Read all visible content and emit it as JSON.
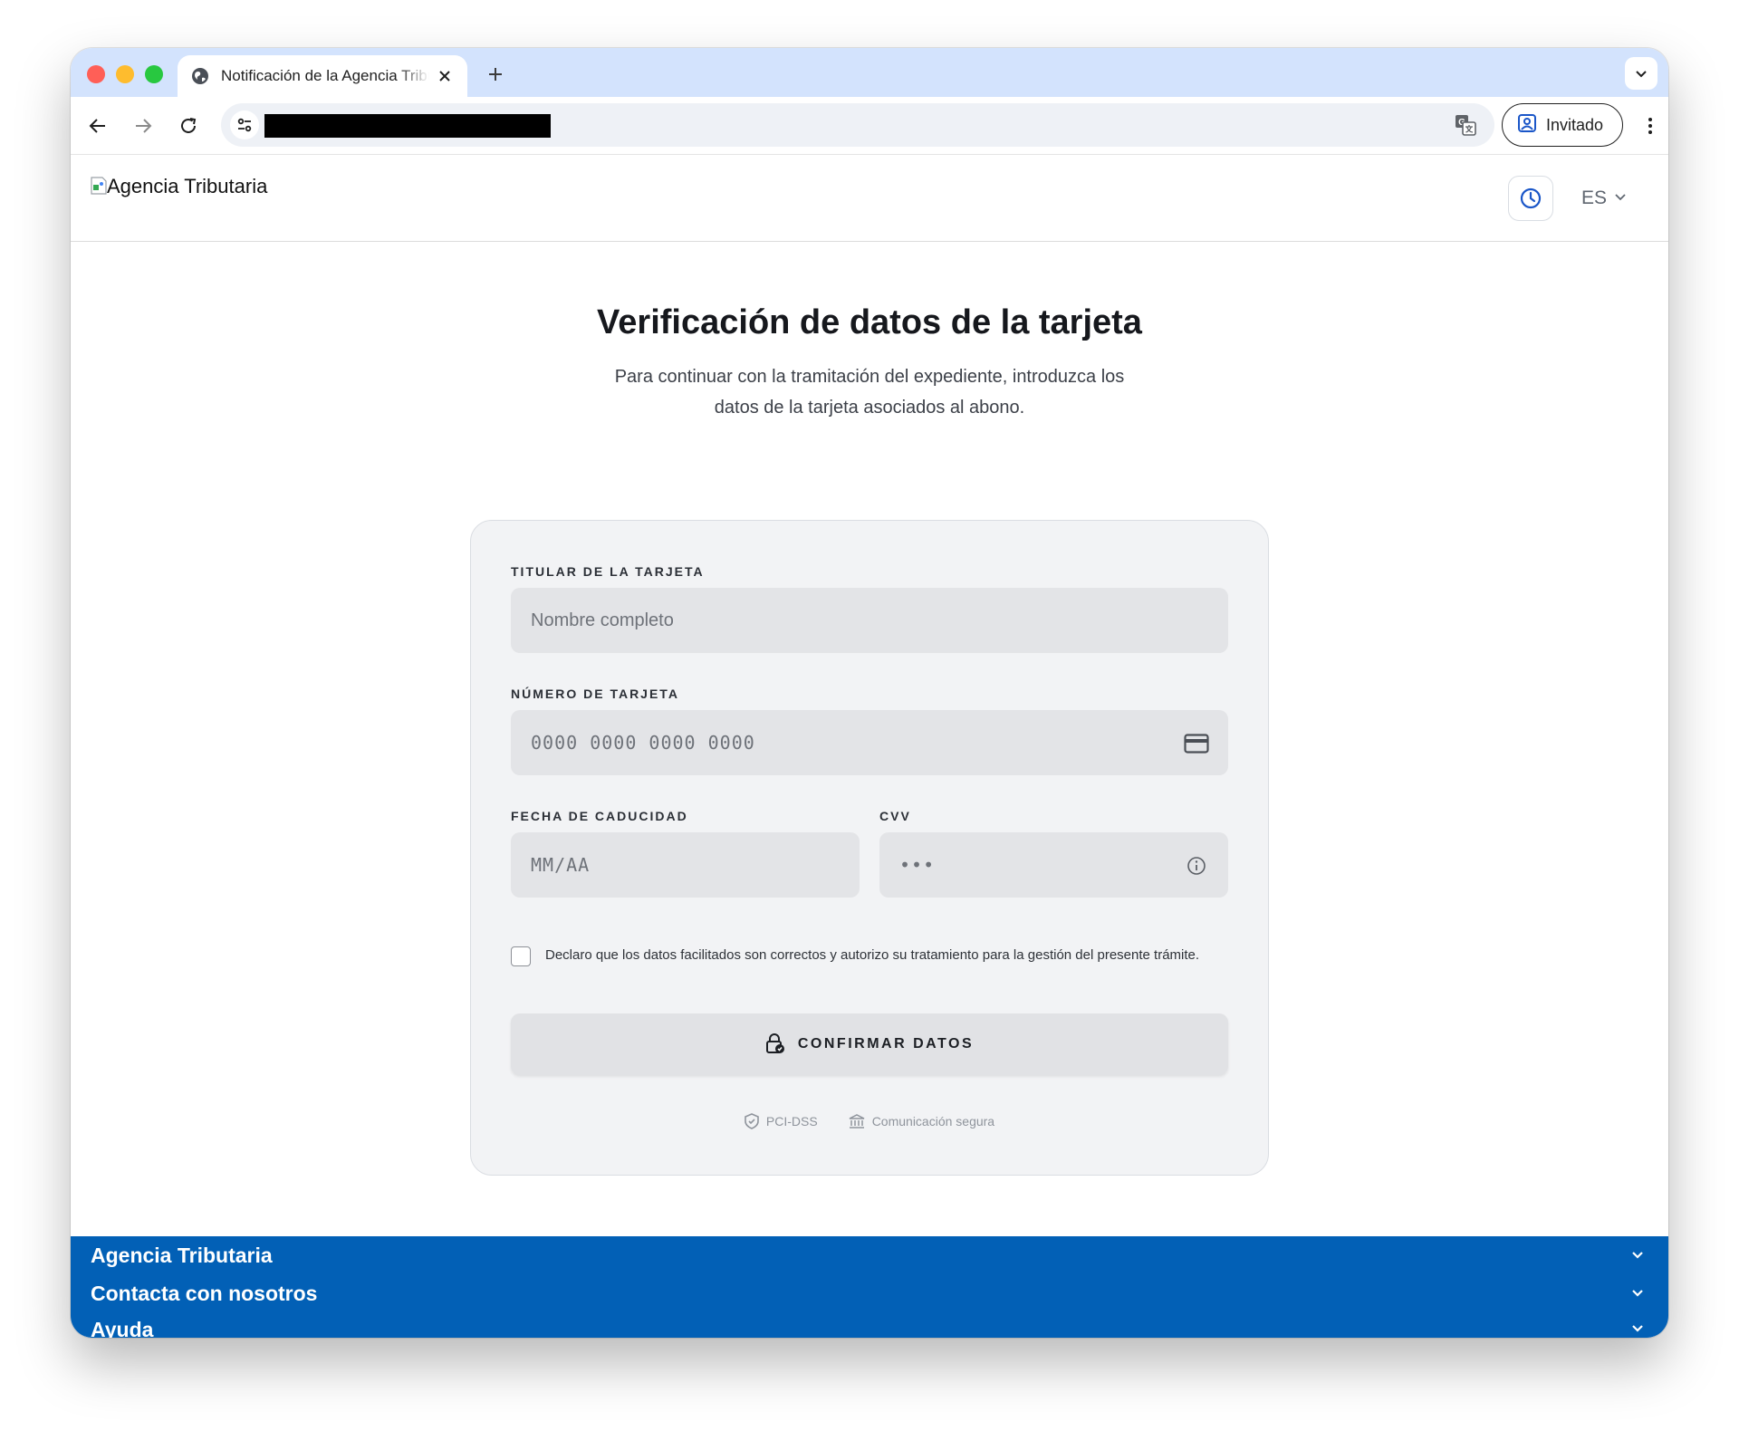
{
  "browser": {
    "tab_title": "Notificación de la Agencia Tributaria",
    "profile_label": "Invitado"
  },
  "site": {
    "logo_alt": "Agencia Tributaria",
    "language": "ES"
  },
  "main": {
    "title": "Verificación de datos de la tarjeta",
    "subtitle": "Para continuar con la tramitación del expediente, introduzca los datos de la tarjeta asociados al abono."
  },
  "form": {
    "holder_label": "TITULAR DE LA TARJETA",
    "holder_placeholder": "Nombre completo",
    "number_label": "NÚMERO DE TARJETA",
    "number_placeholder": "0000 0000 0000 0000",
    "expiry_label": "FECHA DE CADUCIDAD",
    "expiry_placeholder": "MM/AA",
    "cvv_label": "CVV",
    "cvv_placeholder": "•••",
    "consent_text": "Declaro que los datos facilitados son correctos y autorizo su tratamiento para la gestión del presente trámite.",
    "confirm_label": "CONFIRMAR DATOS",
    "badges": [
      "PCI-DSS",
      "Comunicación segura"
    ]
  },
  "footer": {
    "items": [
      "Agencia Tributaria",
      "Contacta con nosotros",
      "Ayuda"
    ]
  },
  "colors": {
    "footer_bg": "#0260b6",
    "tabstrip_bg": "#d3e3fd",
    "accent_blue": "#1a56c8"
  }
}
